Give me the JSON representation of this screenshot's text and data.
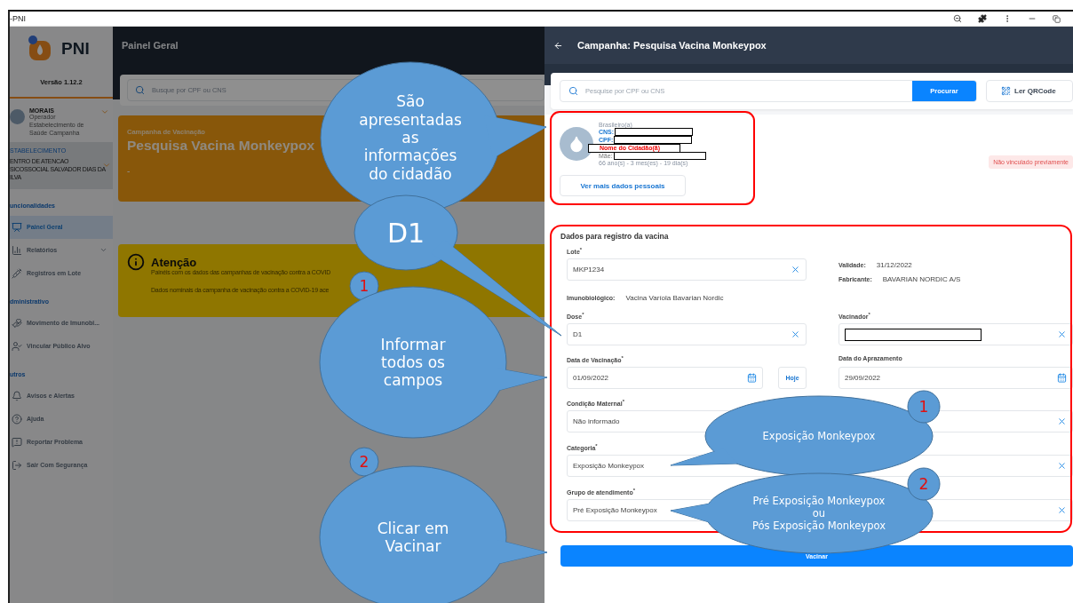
{
  "browser": {
    "title": "-PNI"
  },
  "sidebar": {
    "app_name": "PNI",
    "version": "Versão 1.12.2",
    "user": {
      "name": "MORAIS",
      "role": "Operador Estabelecimento de Saúde Campanha"
    },
    "establishment": {
      "label": "STABELECIMENTO",
      "name_lines": [
        "ENTRO DE ATENCAO",
        "SICOSSOCIAL SALVADOR DIAS DA",
        "ILVA"
      ]
    },
    "sections": [
      {
        "label": "uncionalidades",
        "items": [
          {
            "label": "Painel Geral",
            "selected": true,
            "submenu": false
          },
          {
            "label": "Relatórios",
            "selected": false,
            "submenu": true
          },
          {
            "label": "Registros em Lote",
            "selected": false,
            "submenu": false
          }
        ]
      },
      {
        "label": "dministrativo",
        "items": [
          {
            "label": "Movimento de Imunobi...",
            "selected": false,
            "submenu": false
          },
          {
            "label": "Vincular Público Alvo",
            "selected": false,
            "submenu": false
          }
        ]
      },
      {
        "label": "utros",
        "items": [
          {
            "label": "Avisos e Alertas",
            "selected": false,
            "submenu": false
          },
          {
            "label": "Ajuda",
            "selected": false,
            "submenu": false
          },
          {
            "label": "Reportar Problema",
            "selected": false,
            "submenu": false
          },
          {
            "label": "Sair Com Segurança",
            "selected": false,
            "submenu": false
          }
        ]
      }
    ]
  },
  "main": {
    "title": "Painel Geral",
    "search_placeholder": "Busque por CPF ou CNS",
    "campaign": {
      "label": "Campanha de Vacinação",
      "name": "Pesquisa Vacina Monkeypox",
      "period": "-"
    },
    "notice": {
      "title": "Atenção",
      "lines": [
        "Painéis com os dados das campanhas de vacinação contra a COVID",
        "Dados nominais da campanha de vacinação contra a COVID-19 ace"
      ]
    }
  },
  "drawer": {
    "title": "Campanha: Pesquisa Vacina Monkeypox",
    "search": {
      "placeholder": "Pesquise por CPF ou CNS",
      "button": "Procurar",
      "qr_button": "Ler QRCode"
    },
    "citizen": {
      "nationality": "Brasileiro(a)",
      "cns_label": "CNS:",
      "cpf_label": "CPF:",
      "name": "Nome do Cidadão(ã)",
      "mother_label": "Mãe:",
      "age": "66 ano(s) - 3 mes(es) - 19 dia(s)",
      "more_button": "Ver mais dados pessoais",
      "status": "Não vinculado previamente"
    },
    "form": {
      "title": "Dados para registro da vacina",
      "lot": {
        "label": "Lote$^{*}$",
        "value": "MKP1234"
      },
      "expiry": {
        "label": "Validade:",
        "value": "31/12/2022"
      },
      "maker": {
        "label": "Fabricante:",
        "value": "BAVARIAN NORDIC A/S"
      },
      "vaccine": {
        "label": "Imunobiológico:",
        "value": "Vacina Varíola Bavarian Nordic"
      },
      "dose": {
        "label": "Dose$^{*}$",
        "value": "D1"
      },
      "vaccinator": {
        "label": "Vacinador$^{*}$"
      },
      "vaccination_date": {
        "label": "Data de Vacinação$^{*}$",
        "value": "01/09/2022"
      },
      "today_button": "Hoje",
      "schedule_date": {
        "label": "Data do Aprazamento",
        "value": "29/09/2022"
      },
      "maternal": {
        "label": "Condição Maternal$^{*}$",
        "value": "Não informado"
      },
      "category": {
        "label": "Categoria$^{*}$",
        "value": "Exposição Monkeypox"
      },
      "group": {
        "label": "Grupo de atendimento$^{*}$",
        "value": "Pré Exposição Monkeypox"
      },
      "submit": "Vacinar"
    }
  },
  "annotations": [
    {
      "kind": "bubble",
      "text": "São\napresentadas\nas\ninformações\ndo cidadão"
    },
    {
      "kind": "bubble",
      "text": "D1"
    },
    {
      "kind": "number",
      "text": "1"
    },
    {
      "kind": "bubble",
      "text": "Informar\ntodos os\ncampos"
    },
    {
      "kind": "number",
      "text": "2"
    },
    {
      "kind": "bubble",
      "text": "Clicar em\nVacinar"
    },
    {
      "kind": "bubble",
      "text": "Exposição Monkeypox"
    },
    {
      "kind": "number",
      "text": "1"
    },
    {
      "kind": "bubble",
      "text": "Pré Exposição Monkeypox\nou\nPós Exposição Monkeypox"
    },
    {
      "kind": "number",
      "text": "2"
    }
  ]
}
